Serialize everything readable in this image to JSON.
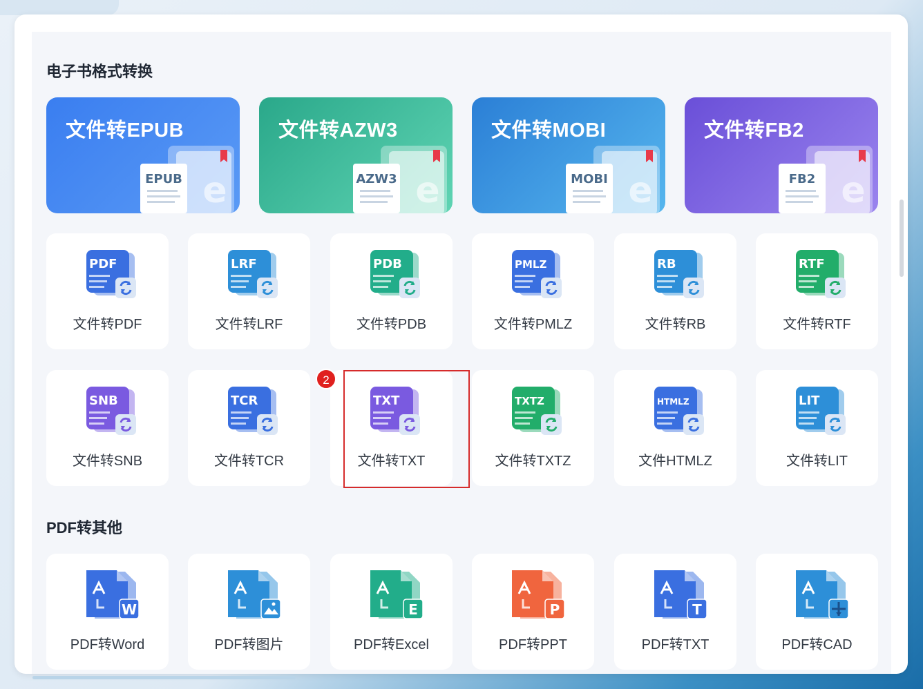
{
  "sections": {
    "ebook_title": "电子书格式转换",
    "pdf_title": "PDF转其他"
  },
  "banners": [
    {
      "label": "文件转EPUB",
      "file_tag": "EPUB",
      "bg_from": "#3a7ef0",
      "bg_to": "#5a9af5",
      "icon": "epub-book-icon"
    },
    {
      "label": "文件转AZW3",
      "file_tag": "AZW3",
      "bg_from": "#2aa88a",
      "bg_to": "#5fd4b3",
      "icon": "azw3-book-icon"
    },
    {
      "label": "文件转MOBI",
      "file_tag": "MOBI",
      "bg_from": "#2b7fd6",
      "bg_to": "#56b6ee",
      "icon": "mobi-book-icon"
    },
    {
      "label": "文件转FB2",
      "file_tag": "FB2",
      "bg_from": "#6a4fd8",
      "bg_to": "#9a84ee",
      "icon": "fb2-book-icon"
    }
  ],
  "ebook_row1": [
    {
      "label": "文件转PDF",
      "tag": "PDF",
      "color": "#3a6fe0",
      "icon": "pdf-convert-icon"
    },
    {
      "label": "文件转LRF",
      "tag": "LRF",
      "color": "#2d8fd8",
      "icon": "lrf-convert-icon"
    },
    {
      "label": "文件转PDB",
      "tag": "PDB",
      "color": "#22ad8a",
      "icon": "pdb-convert-icon"
    },
    {
      "label": "文件转PMLZ",
      "tag": "PMLZ",
      "color": "#3a6fe0",
      "icon": "pmlz-convert-icon"
    },
    {
      "label": "文件转RB",
      "tag": "RB",
      "color": "#2d8fd8",
      "icon": "rb-convert-icon"
    },
    {
      "label": "文件转RTF",
      "tag": "RTF",
      "color": "#22ad6a",
      "icon": "rtf-convert-icon"
    }
  ],
  "ebook_row2": [
    {
      "label": "文件转SNB",
      "tag": "SNB",
      "color": "#7a5ae0",
      "icon": "snb-convert-icon"
    },
    {
      "label": "文件转TCR",
      "tag": "TCR",
      "color": "#3a6fe0",
      "icon": "tcr-convert-icon"
    },
    {
      "label": "文件转TXT",
      "tag": "TXT",
      "color": "#7a5ae0",
      "icon": "txt-convert-icon"
    },
    {
      "label": "文件转TXTZ",
      "tag": "TXTZ",
      "color": "#22ad6a",
      "icon": "txtz-convert-icon"
    },
    {
      "label": "文件HTMLZ",
      "tag": "HTMLZ",
      "color": "#3a6fe0",
      "icon": "htmlz-convert-icon"
    },
    {
      "label": "文件转LIT",
      "tag": "LIT",
      "color": "#2d8fd8",
      "icon": "lit-convert-icon"
    }
  ],
  "pdf_row": [
    {
      "label": "PDF转Word",
      "glyph": "W",
      "color": "#3a6fe0",
      "icon": "pdf-to-word-icon"
    },
    {
      "label": "PDF转图片",
      "glyph": "▲",
      "color": "#2d8fd8",
      "icon": "pdf-to-image-icon"
    },
    {
      "label": "PDF转Excel",
      "glyph": "E",
      "color": "#22ad8a",
      "icon": "pdf-to-excel-icon"
    },
    {
      "label": "PDF转PPT",
      "glyph": "P",
      "color": "#f0653e",
      "icon": "pdf-to-ppt-icon"
    },
    {
      "label": "PDF转TXT",
      "glyph": "T",
      "color": "#3a6fe0",
      "icon": "pdf-to-txt-icon"
    },
    {
      "label": "PDF转CAD",
      "glyph": "+",
      "color": "#2d8fd8",
      "icon": "pdf-to-cad-icon"
    }
  ],
  "badge": "2"
}
